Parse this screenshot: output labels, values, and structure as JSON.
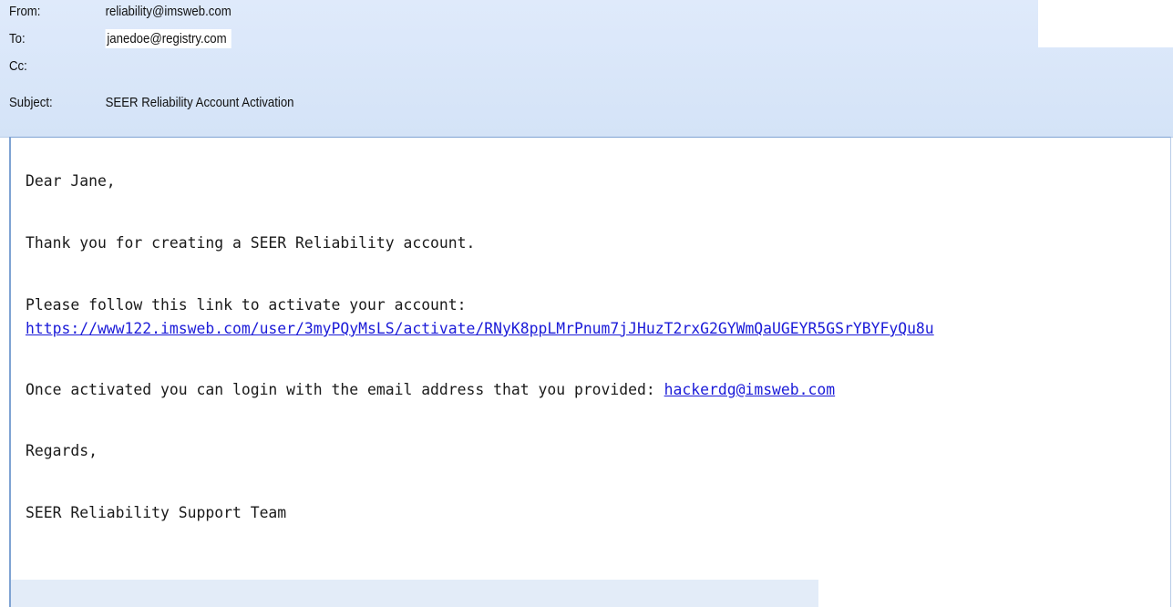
{
  "header": {
    "from_label": "From:",
    "from_value": "reliability@imsweb.com",
    "to_label": "To:",
    "to_value": "janedoe@registry.com",
    "cc_label": "Cc:",
    "cc_value": "",
    "subject_label": "Subject:",
    "subject_value": "SEER Reliability Account Activation"
  },
  "body": {
    "greeting": "Dear Jane,",
    "thanks": "Thank you for creating a SEER Reliability account.",
    "follow_text": "Please follow this link to activate your account:",
    "activation_link": "https://www122.imsweb.com/user/3myPQyMsLS/activate/RNyK8ppLMrPnum7jJHuzT2rxG2GYWmQaUGEYR5GSrYBYFyQu8u",
    "once_text": "Once activated you can login with the email address that you provided: ",
    "email_link": "hackerdg@imsweb.com",
    "regards": "Regards,",
    "signature": "SEER Reliability Support Team"
  },
  "colors": {
    "header_bg": "#d9e6f8",
    "link": "#1b1bd8",
    "border": "#7fa3d3"
  }
}
